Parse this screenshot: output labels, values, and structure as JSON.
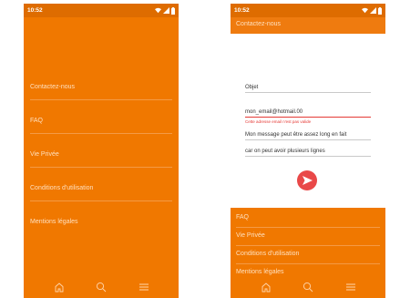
{
  "status_bar": {
    "time": "10:52",
    "icons": [
      "wifi-icon",
      "signal-icon",
      "battery-icon"
    ]
  },
  "left_screen": {
    "menu": [
      {
        "label": "Contactez-nous"
      },
      {
        "label": "FAQ"
      },
      {
        "label": "Vie Privée"
      },
      {
        "label": "Conditions d'utilisation"
      },
      {
        "label": "Mentions légales"
      }
    ]
  },
  "right_screen": {
    "title": "Contactez-nous",
    "form": {
      "subject_placeholder": "Objet",
      "email_value": "mon_email@hotmail.00",
      "email_error": "Cette adresse email n'est pas valide",
      "message_line1": "Mon message peut être assez long en fait",
      "message_line2": "car on peut avoir plusieurs lignes"
    },
    "menu": [
      {
        "label": "FAQ"
      },
      {
        "label": "Vie Privée"
      },
      {
        "label": "Conditions d'utilisation"
      },
      {
        "label": "Mentions légales"
      }
    ]
  },
  "bottom_nav": {
    "icons": [
      "home-icon",
      "search-icon",
      "menu-icon"
    ]
  },
  "colors": {
    "primary": "#f07800",
    "status_bar": "#de6c00",
    "menu_text": "#ffe0bf",
    "error": "#e53935",
    "send_button": "#e94848"
  }
}
